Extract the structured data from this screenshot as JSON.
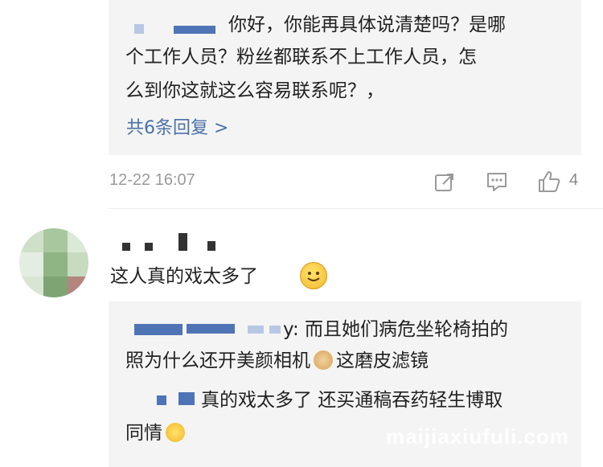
{
  "first_thread": {
    "reply_lines": [
      "你好，你能再具体说清楚吗？是哪",
      "个工作人员？粉丝都联系不上工作人员，怎",
      "么到你这就这么容易联系呢？，"
    ],
    "more_replies": "共6条回复 >",
    "timestamp": "12-22 16:07",
    "like_count": "4",
    "icons": [
      "share-icon",
      "comment-icon",
      "like-icon"
    ]
  },
  "second_comment": {
    "text": "这人真的戏太多了",
    "emoji": "smile-emoji",
    "replies": [
      {
        "lines": [
          "y: 而且她们病危坐轮椅拍的",
          "照为什么还开美颜相机",
          "这磨皮滤镜"
        ],
        "emoji": "doge-emoji"
      },
      {
        "lines": [
          "真的戏太多了 还买通稿吞药轻生博取",
          "同情"
        ],
        "emoji": "smirk-emoji"
      }
    ]
  },
  "watermark": "maijiaxiufuli.com",
  "colors": {
    "link": "#4a72a8",
    "reply_bg": "#f4f4f4",
    "meta": "#9a9a9a"
  }
}
